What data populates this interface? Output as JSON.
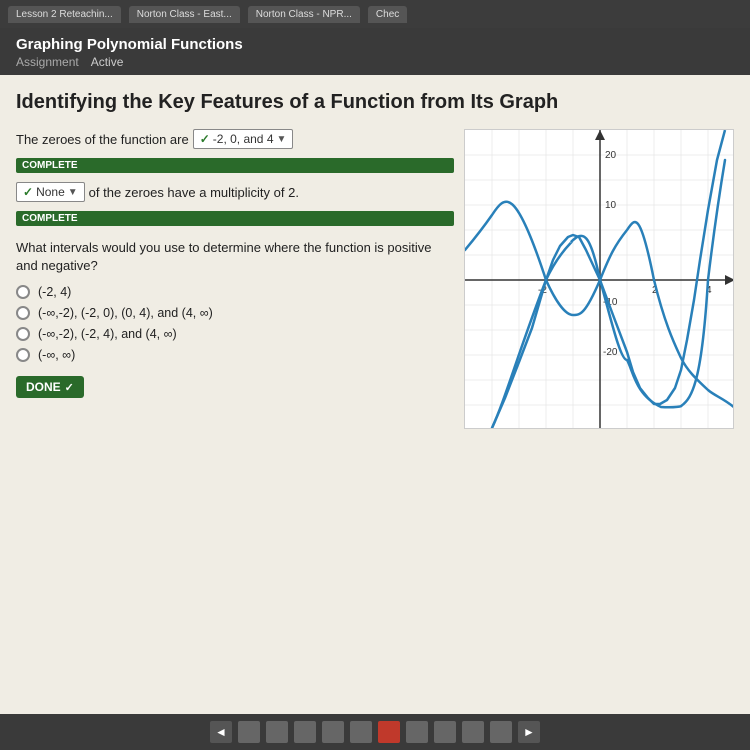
{
  "browser": {
    "tabs": [
      {
        "label": "Lesson 2 Reteachin...",
        "active": false
      },
      {
        "label": "Norton Class - East...",
        "active": false
      },
      {
        "label": "Norton Class - NPR...",
        "active": false
      },
      {
        "label": "Chec",
        "active": false
      }
    ]
  },
  "page": {
    "title": "Graphing Polynomial Functions",
    "assignment_label": "Assignment",
    "status_label": "Active"
  },
  "main": {
    "heading": "Identifying the Key Features of a Function from Its Graph",
    "zeroes_question": "The zeroes of the function are",
    "zeroes_answer": "-2, 0, and 4",
    "complete_label_1": "COMPLETE",
    "multiplicity_prefix": "of the zeroes have a multiplicity of 2.",
    "multiplicity_answer": "None",
    "complete_label_2": "COMPLETE",
    "intervals_question": "What intervals would you use to determine where the function is positive and negative?",
    "options": [
      {
        "id": "a",
        "text": "(-2, 4)"
      },
      {
        "id": "b",
        "text": "(-∞,-2), (-2, 0), (0, 4), and (4, ∞)"
      },
      {
        "id": "c",
        "text": "(-∞,-2), (-2, 4), and (4, ∞)"
      },
      {
        "id": "d",
        "text": "(-∞, ∞)"
      }
    ],
    "done_label": "DONE"
  },
  "graph": {
    "x_label": "",
    "y_label": "",
    "x_min": -4,
    "x_max": 5,
    "y_min": -25,
    "y_max": 22,
    "axis_labels": {
      "y_top": "20",
      "y_mid": "10",
      "y_neg_mid": "-10",
      "y_neg_bot": "-20",
      "x_neg": "-2",
      "x_pos2": "2",
      "x_pos4": "4"
    }
  },
  "nav": {
    "prev_arrow": "◄",
    "next_arrow": "►",
    "dots": [
      0,
      1,
      2,
      3,
      4,
      5,
      6,
      7,
      8,
      9
    ],
    "active_dot": 5
  }
}
